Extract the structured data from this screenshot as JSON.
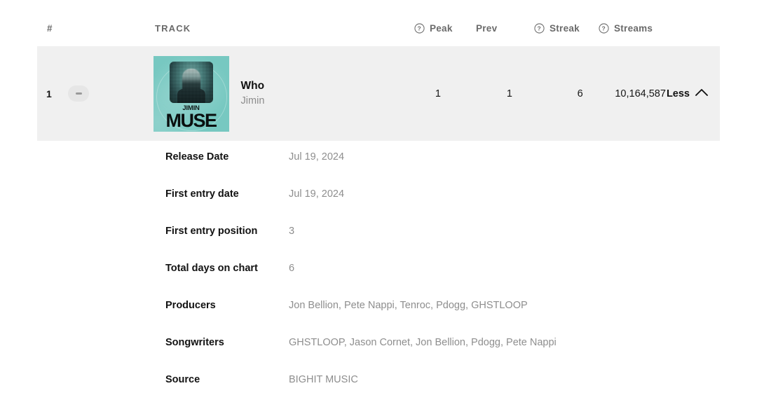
{
  "header": {
    "rank_label": "#",
    "track_label": "TRACK",
    "columns": [
      {
        "label": "Peak",
        "icon": "help-circle-icon",
        "has_icon": true
      },
      {
        "label": "Prev",
        "icon": null,
        "has_icon": false
      },
      {
        "label": "Streak",
        "icon": "help-circle-icon",
        "has_icon": true
      },
      {
        "label": "Streams",
        "icon": "help-circle-icon",
        "has_icon": true
      }
    ]
  },
  "track_row": {
    "rank": "1",
    "trend": "steady",
    "trend_symbol": "–",
    "album_art": {
      "artist_line": "JIMIN",
      "title_line": "MUSE",
      "background_color": "#77c8c1"
    },
    "title": "Who",
    "artist": "Jimin",
    "peak": "1",
    "prev": "1",
    "streak": "6",
    "streams": "10,164,587",
    "toggle_label": "Less",
    "toggle_icon": "chevron-up-icon"
  },
  "details": [
    {
      "label": "Release Date",
      "value": "Jul 19, 2024"
    },
    {
      "label": "First entry date",
      "value": "Jul 19, 2024"
    },
    {
      "label": "First entry position",
      "value": "3"
    },
    {
      "label": "Total days on chart",
      "value": "6"
    },
    {
      "label": "Producers",
      "value": "Jon Bellion, Pete Nappi, Tenroc, Pdogg, GHSTLOOP"
    },
    {
      "label": "Songwriters",
      "value": "GHSTLOOP, Jason Cornet, Jon Bellion, Pdogg, Pete Nappi"
    },
    {
      "label": "Source",
      "value": "BIGHIT MUSIC"
    }
  ],
  "colors": {
    "row_highlight": "#f0f0f0",
    "text_primary": "#121212",
    "text_muted": "#8e8e8e",
    "header_text": "#6a6a6a",
    "pill_bg": "#e6e6e6"
  }
}
